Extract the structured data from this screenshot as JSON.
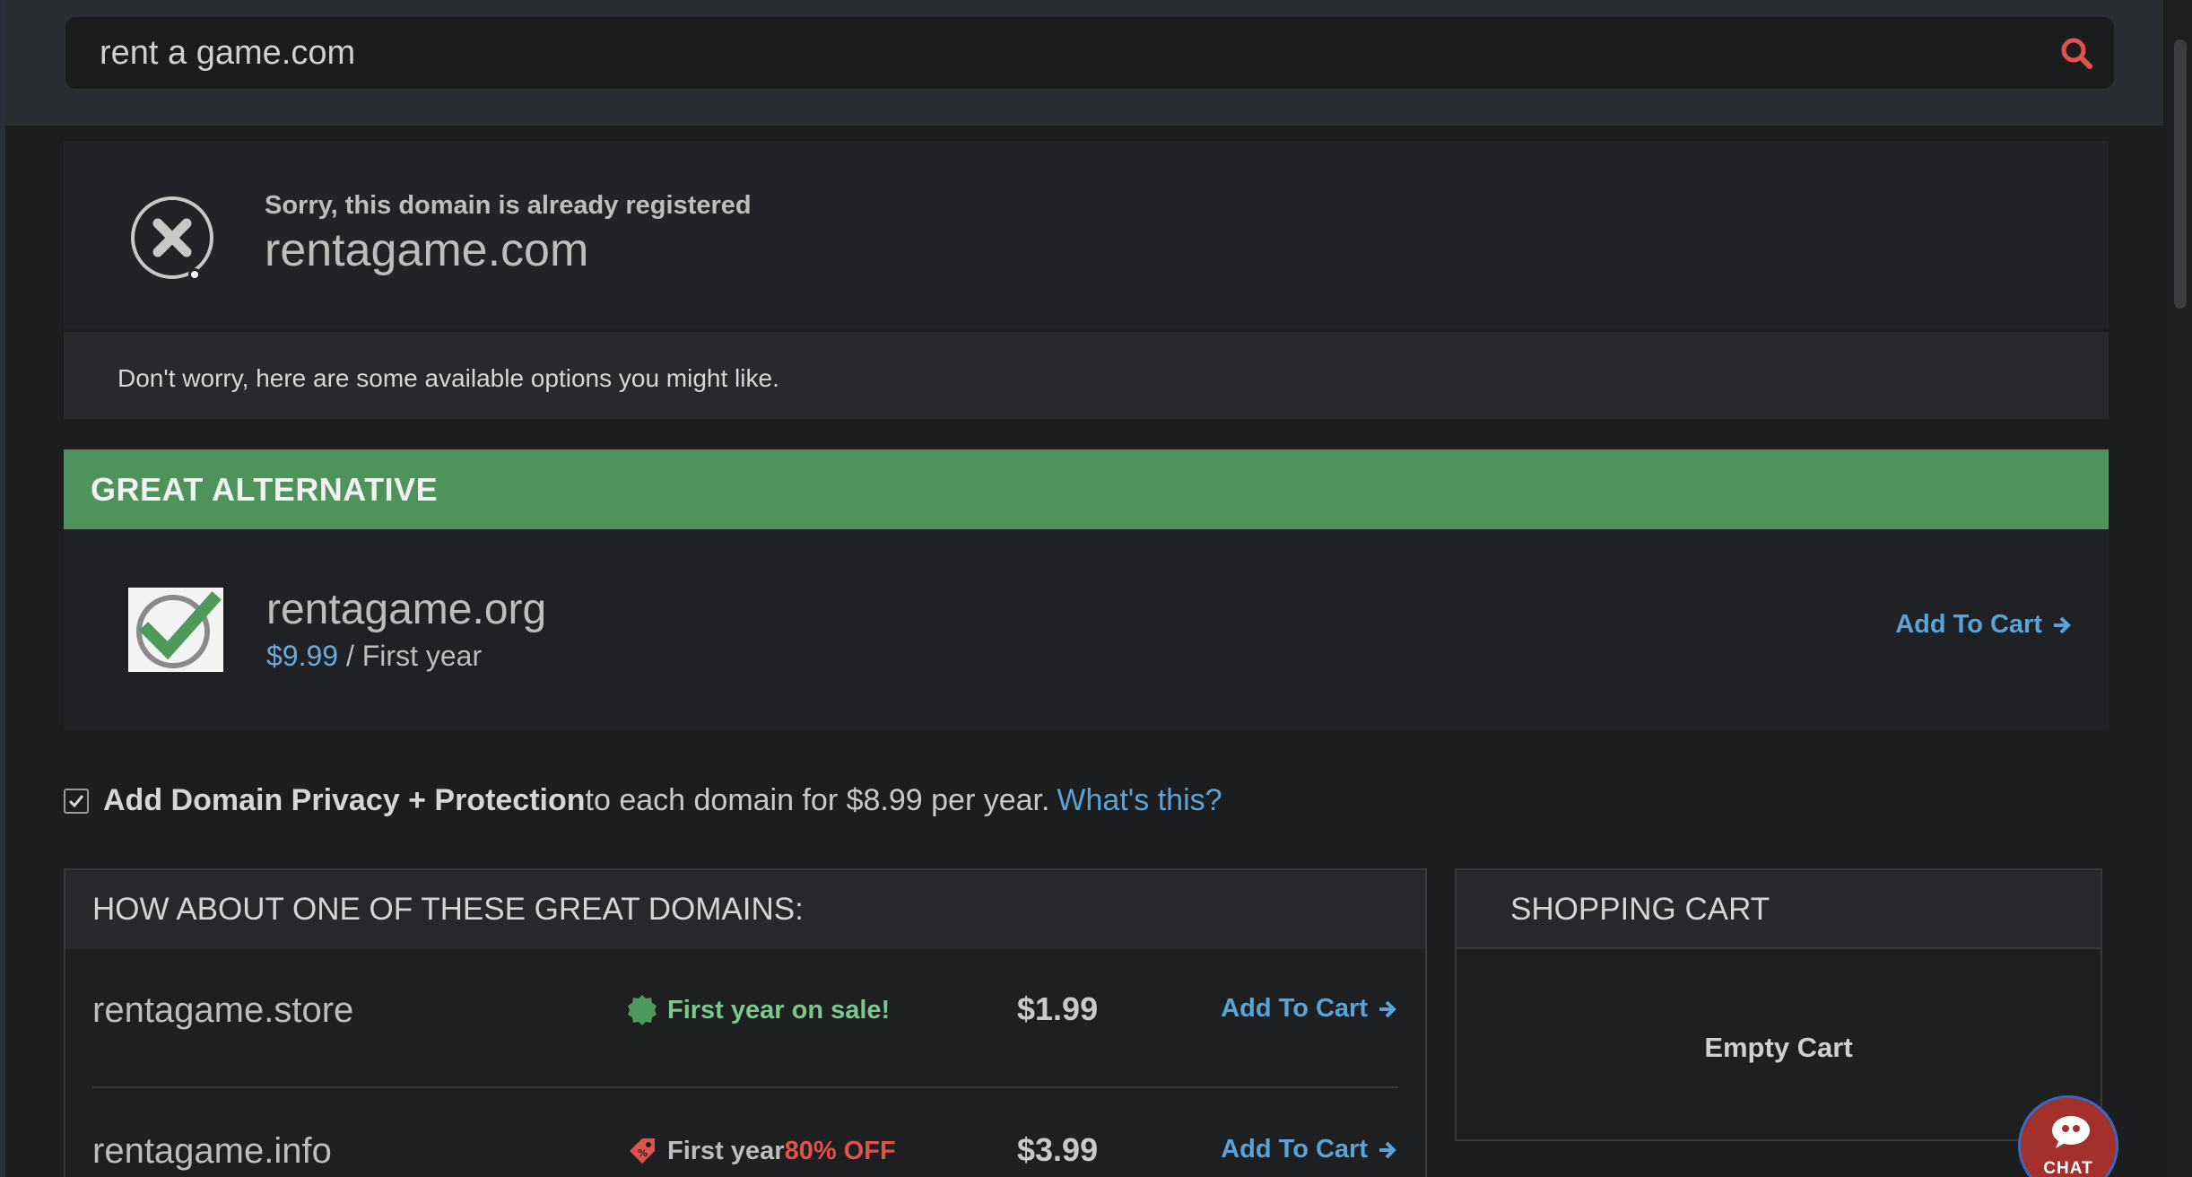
{
  "search": {
    "value": "rent a game.com"
  },
  "result": {
    "status_text": "Sorry, this domain is already registered",
    "domain": "rentagame.com",
    "worry_text": "Don't worry, here are some available options you might like."
  },
  "alternative": {
    "header": "GREAT ALTERNATIVE",
    "domain": "rentagame.org",
    "price": "$9.99",
    "price_suffix": " / First year",
    "add_label": "Add To Cart"
  },
  "privacy": {
    "checked": true,
    "bold_text": "Add Domain Privacy + Protection",
    "text": " to each domain for $8.99 per year.",
    "link": "What's this?"
  },
  "suggestions": {
    "header": "HOW ABOUT ONE OF THESE GREAT DOMAINS:",
    "rows": [
      {
        "domain": "rentagame.store",
        "promo_icon": "badge-icon",
        "promo_text": "First year on sale!",
        "price": "$1.99",
        "add_label": "Add To Cart"
      },
      {
        "domain": "rentagame.info",
        "promo_icon": "tag-icon",
        "promo_prefix": "First year ",
        "promo_highlight": "80% OFF",
        "price": "$3.99",
        "add_label": "Add To Cart"
      }
    ]
  },
  "cart": {
    "header": "SHOPPING CART",
    "empty_text": "Empty Cart"
  },
  "chat": {
    "label": "CHAT"
  },
  "colors": {
    "accent_green": "#4e935c",
    "link_blue": "#5aa3d8",
    "sale_red": "#e0524a",
    "search_icon": "#e0524a",
    "chat_bg": "#a3302a"
  }
}
